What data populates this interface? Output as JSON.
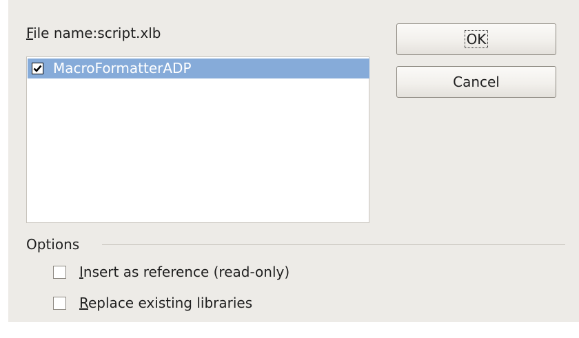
{
  "dialog": {
    "file_name_label": {
      "mnemonic": "F",
      "rest": "ile name:",
      "value": "script.xlb"
    },
    "libraries": [
      {
        "label": "MacroFormatterADP",
        "checked": true,
        "selected": true
      }
    ],
    "buttons": {
      "ok_label": "OK",
      "cancel_label": "Cancel"
    },
    "options": {
      "heading": "Options",
      "insert_reference": {
        "mnemonic": "I",
        "rest": "nsert as reference (read-only)",
        "checked": false
      },
      "replace_existing": {
        "mnemonic": "R",
        "rest": "eplace existing libraries",
        "checked": false
      }
    },
    "colors": {
      "dialog_bg": "#edebe7",
      "selection": "#86abd9",
      "text": "#1e1e1e"
    },
    "icons": {
      "list_checkbox": "checkmark-icon"
    }
  }
}
